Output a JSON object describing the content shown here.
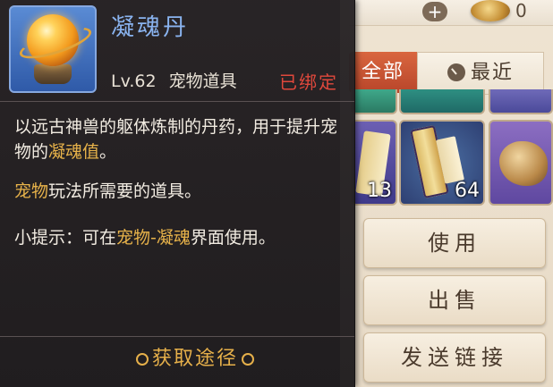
{
  "header": {
    "plus_symbol": "+",
    "gold_count": "0"
  },
  "tabs": {
    "all_label": "全部",
    "recent_label": "最近"
  },
  "inventory": {
    "slots": [
      {
        "count": "13"
      },
      {
        "count": "64"
      }
    ]
  },
  "actions": {
    "use_label": "使用",
    "sell_label": "出售",
    "send_link_label": "发送链接"
  },
  "tooltip": {
    "item_name": "凝魂丹",
    "level": "Lv.62",
    "category": "宠物道具",
    "bound_status": "已绑定",
    "desc1_a": "以远古神兽的躯体炼制的丹药，用于提升宠物的",
    "desc1_hl": "凝魂值",
    "desc1_b": "。",
    "desc2_hl": "宠物",
    "desc2_b": "玩法所需要的道具。",
    "desc3_a": "小提示：可在",
    "desc3_hl": "宠物-凝魂",
    "desc3_b": "界面使用。",
    "source_label": "获取途径"
  },
  "colors": {
    "item_name": "#8ab4f0",
    "bound": "#e0483c",
    "highlight": "#e8b34a",
    "active_tab": "#c8532f"
  },
  "icons": {
    "item": "golden-orb-icon",
    "recent_tab": "clock-icon",
    "currency": "gold-ingot-icon"
  }
}
